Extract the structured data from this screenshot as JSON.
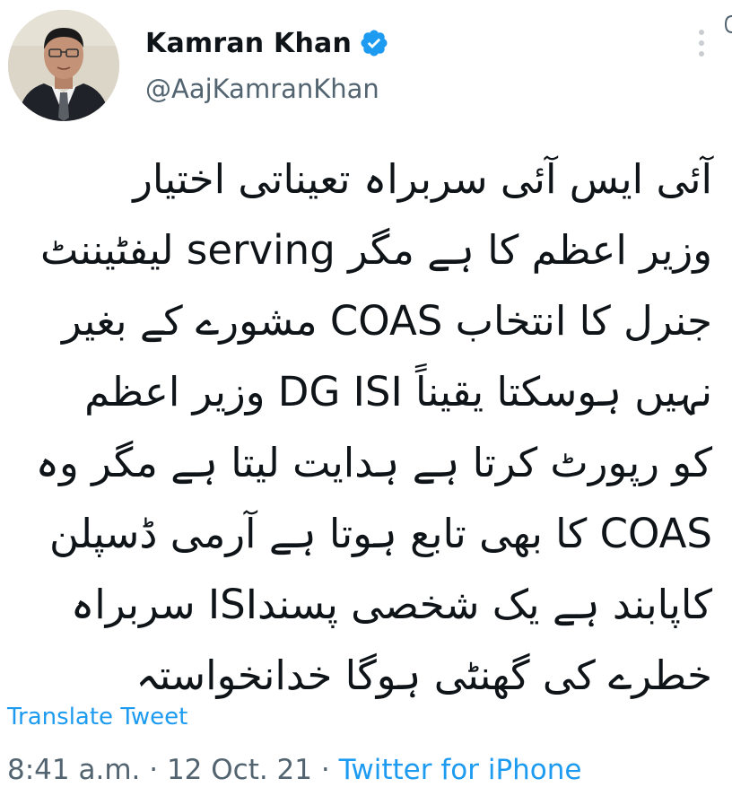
{
  "author": {
    "display_name": "Kamran Khan",
    "handle": "@AajKamranKhan",
    "verified": true,
    "verified_icon": "verified-badge-icon",
    "avatar": "profile-photo"
  },
  "tweet": {
    "lines": [
      "آئی ایس آئی سربراہ تعیناتی اختیار",
      "وزیر اعظم کا ہے مگر serving لیفٹیننٹ",
      "جنرل کا انتخاب COAS مشورے کے بغیر",
      "نہیں ہوسکتا یقیناً DG ISI وزیر اعظم",
      "کو رپورٹ کرتا ہے ہدایت لیتا ہے مگر وہ",
      "COAS کا بھی تابع ہوتا ہے آرمی ڈسپلن",
      "کاپابند ہے یک شخصی پسندISI سربراہ",
      "خطرے کی گھنٹی ہوگا خدانخواستہ"
    ],
    "translate_label": "Translate Tweet",
    "time": "8:41 a.m.",
    "date": "12 Oct. 21",
    "separator": "·",
    "source": "Twitter for iPhone"
  },
  "colors": {
    "text": "#0f1419",
    "secondary": "#536471",
    "link": "#1d9bf0"
  },
  "icons": {
    "more": "more-vertical-icon"
  }
}
